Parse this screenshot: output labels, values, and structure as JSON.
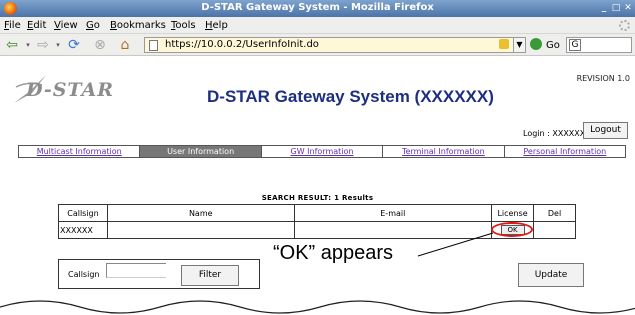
{
  "window": {
    "title": "D-STAR Gateway System - Mozilla Firefox"
  },
  "menu": [
    {
      "label": "File",
      "u": "F",
      "rest": "ile"
    },
    {
      "label": "Edit",
      "u": "E",
      "rest": "dit"
    },
    {
      "label": "View",
      "u": "V",
      "rest": "iew"
    },
    {
      "label": "Go",
      "u": "G",
      "rest": "o"
    },
    {
      "label": "Bookmarks",
      "u": "B",
      "rest": "ookmarks"
    },
    {
      "label": "Tools",
      "u": "T",
      "rest": "ools"
    },
    {
      "label": "Help",
      "u": "H",
      "rest": "elp"
    }
  ],
  "navbar": {
    "url": "https://10.0.0.2/UserInfoInit.do",
    "go_label": "Go",
    "search_engine_glyph": "G"
  },
  "page": {
    "logo_text": "D-STAR",
    "revision": "REVISION 1.0",
    "title": "D-STAR Gateway System (XXXXXX)",
    "login_text": "Login : XXXXXX",
    "logout_label": "Logout",
    "tabs": [
      {
        "label": "Multicast Information",
        "active": false
      },
      {
        "label": "User Information",
        "active": true
      },
      {
        "label": "GW Information",
        "active": false
      },
      {
        "label": "Terminal Information",
        "active": false
      },
      {
        "label": "Personal Information",
        "active": false
      }
    ],
    "result_caption": "SEARCH RESULT:  1  Results",
    "table": {
      "headers": [
        "Callsign",
        "Name",
        "E-mail",
        "License",
        "Del"
      ],
      "rows": [
        {
          "callsign": "XXXXXX",
          "name": "",
          "email": "",
          "license": "OK",
          "del": ""
        }
      ]
    },
    "annotation": "“OK” appears",
    "filter": {
      "label": "Callsign",
      "value": "",
      "button": "Filter"
    },
    "update_label": "Update"
  },
  "colors": {
    "title_blue": "#1c2f80",
    "annotation_circle": "#e01818",
    "active_tab": "#777777",
    "link_purple": "#6030b0"
  }
}
